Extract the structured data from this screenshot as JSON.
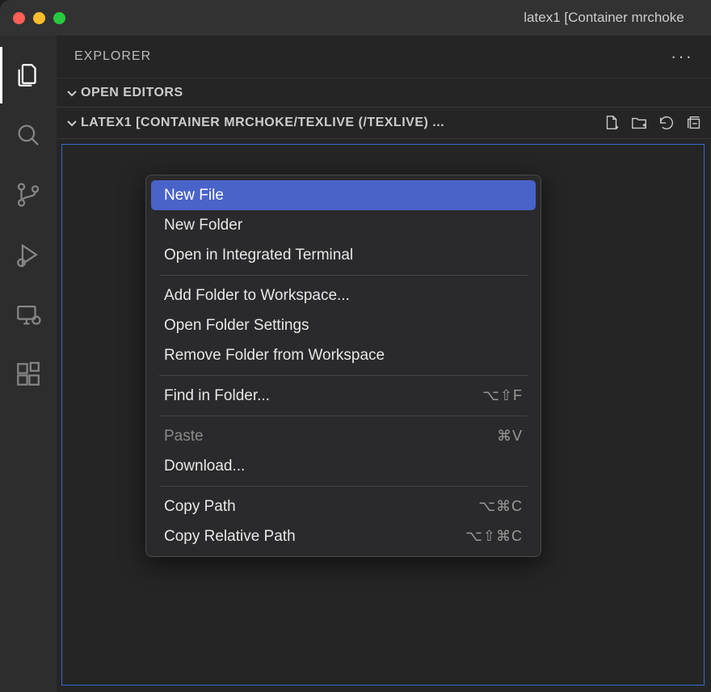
{
  "window": {
    "title": "latex1 [Container mrchoke"
  },
  "sidebar": {
    "title": "EXPLORER"
  },
  "sections": {
    "open_editors": "OPEN EDITORS",
    "workspace": "LATEX1 [CONTAINER MRCHOKE/TEXLIVE (/TEXLIVE) ..."
  },
  "context_menu": {
    "new_file": "New File",
    "new_folder": "New Folder",
    "open_terminal": "Open in Integrated Terminal",
    "add_folder": "Add Folder to Workspace...",
    "open_folder_settings": "Open Folder Settings",
    "remove_folder": "Remove Folder from Workspace",
    "find_in_folder": "Find in Folder...",
    "find_in_folder_sc": "⌥⇧F",
    "paste": "Paste",
    "paste_sc": "⌘V",
    "download": "Download...",
    "copy_path": "Copy Path",
    "copy_path_sc": "⌥⌘C",
    "copy_rel_path": "Copy Relative Path",
    "copy_rel_path_sc": "⌥⇧⌘C"
  }
}
